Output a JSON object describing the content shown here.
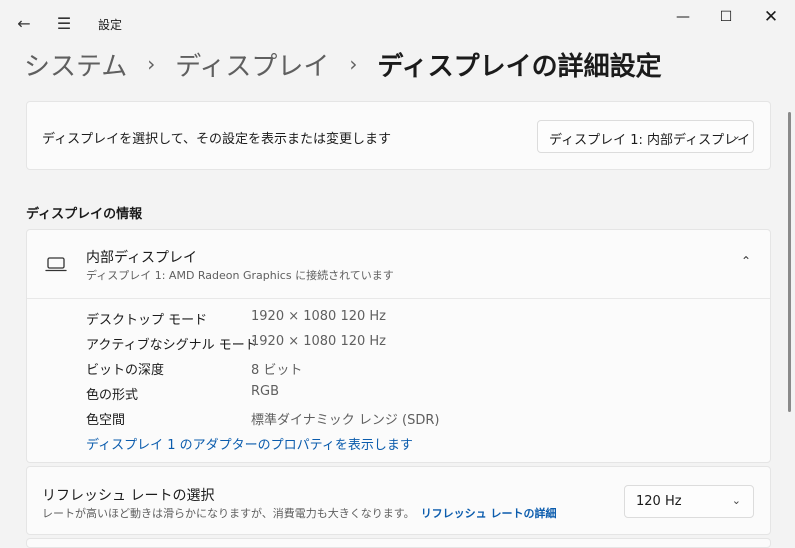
{
  "titlebar": {
    "back_icon": "←",
    "menu_icon": "☰",
    "app_title": "設定",
    "minimize_icon": "—",
    "maximize_icon": "☐",
    "close_icon": "✕"
  },
  "breadcrumb": {
    "items": [
      "システム",
      "ディスプレイ"
    ],
    "separator": "›",
    "current": "ディスプレイの詳細設定"
  },
  "display_select": {
    "label": "ディスプレイを選択して、その設定を表示または変更します",
    "selected": "ディスプレイ 1: 内部ディスプレイ",
    "chevron": "⌄"
  },
  "section": {
    "title": "ディスプレイの情報"
  },
  "display_info": {
    "title": "内部ディスプレイ",
    "subtitle": "ディスプレイ 1: AMD Radeon Graphics に接続されています",
    "collapse_icon": "⌃",
    "properties": [
      {
        "label": "デスクトップ モード",
        "value": "1920 × 1080 120 Hz"
      },
      {
        "label": "アクティブなシグナル モード",
        "value": "1920 × 1080 120 Hz"
      },
      {
        "label": "ビットの深度",
        "value": "8 ビット"
      },
      {
        "label": "色の形式",
        "value": "RGB"
      },
      {
        "label": "色空間",
        "value": "標準ダイナミック レンジ (SDR)"
      }
    ],
    "adapter_link": "ディスプレイ 1 のアダプターのプロパティを表示します"
  },
  "refresh": {
    "title": "リフレッシュ レートの選択",
    "description": "レートが高いほど動きは滑らかになりますが、消費電力も大きくなります。",
    "link": "リフレッシュ レートの詳細",
    "selected": "120 Hz",
    "chevron": "⌄"
  },
  "colors": {
    "accent_link": "#0b5cad",
    "background": "#f3f3f3",
    "card": "#fbfbfb"
  }
}
